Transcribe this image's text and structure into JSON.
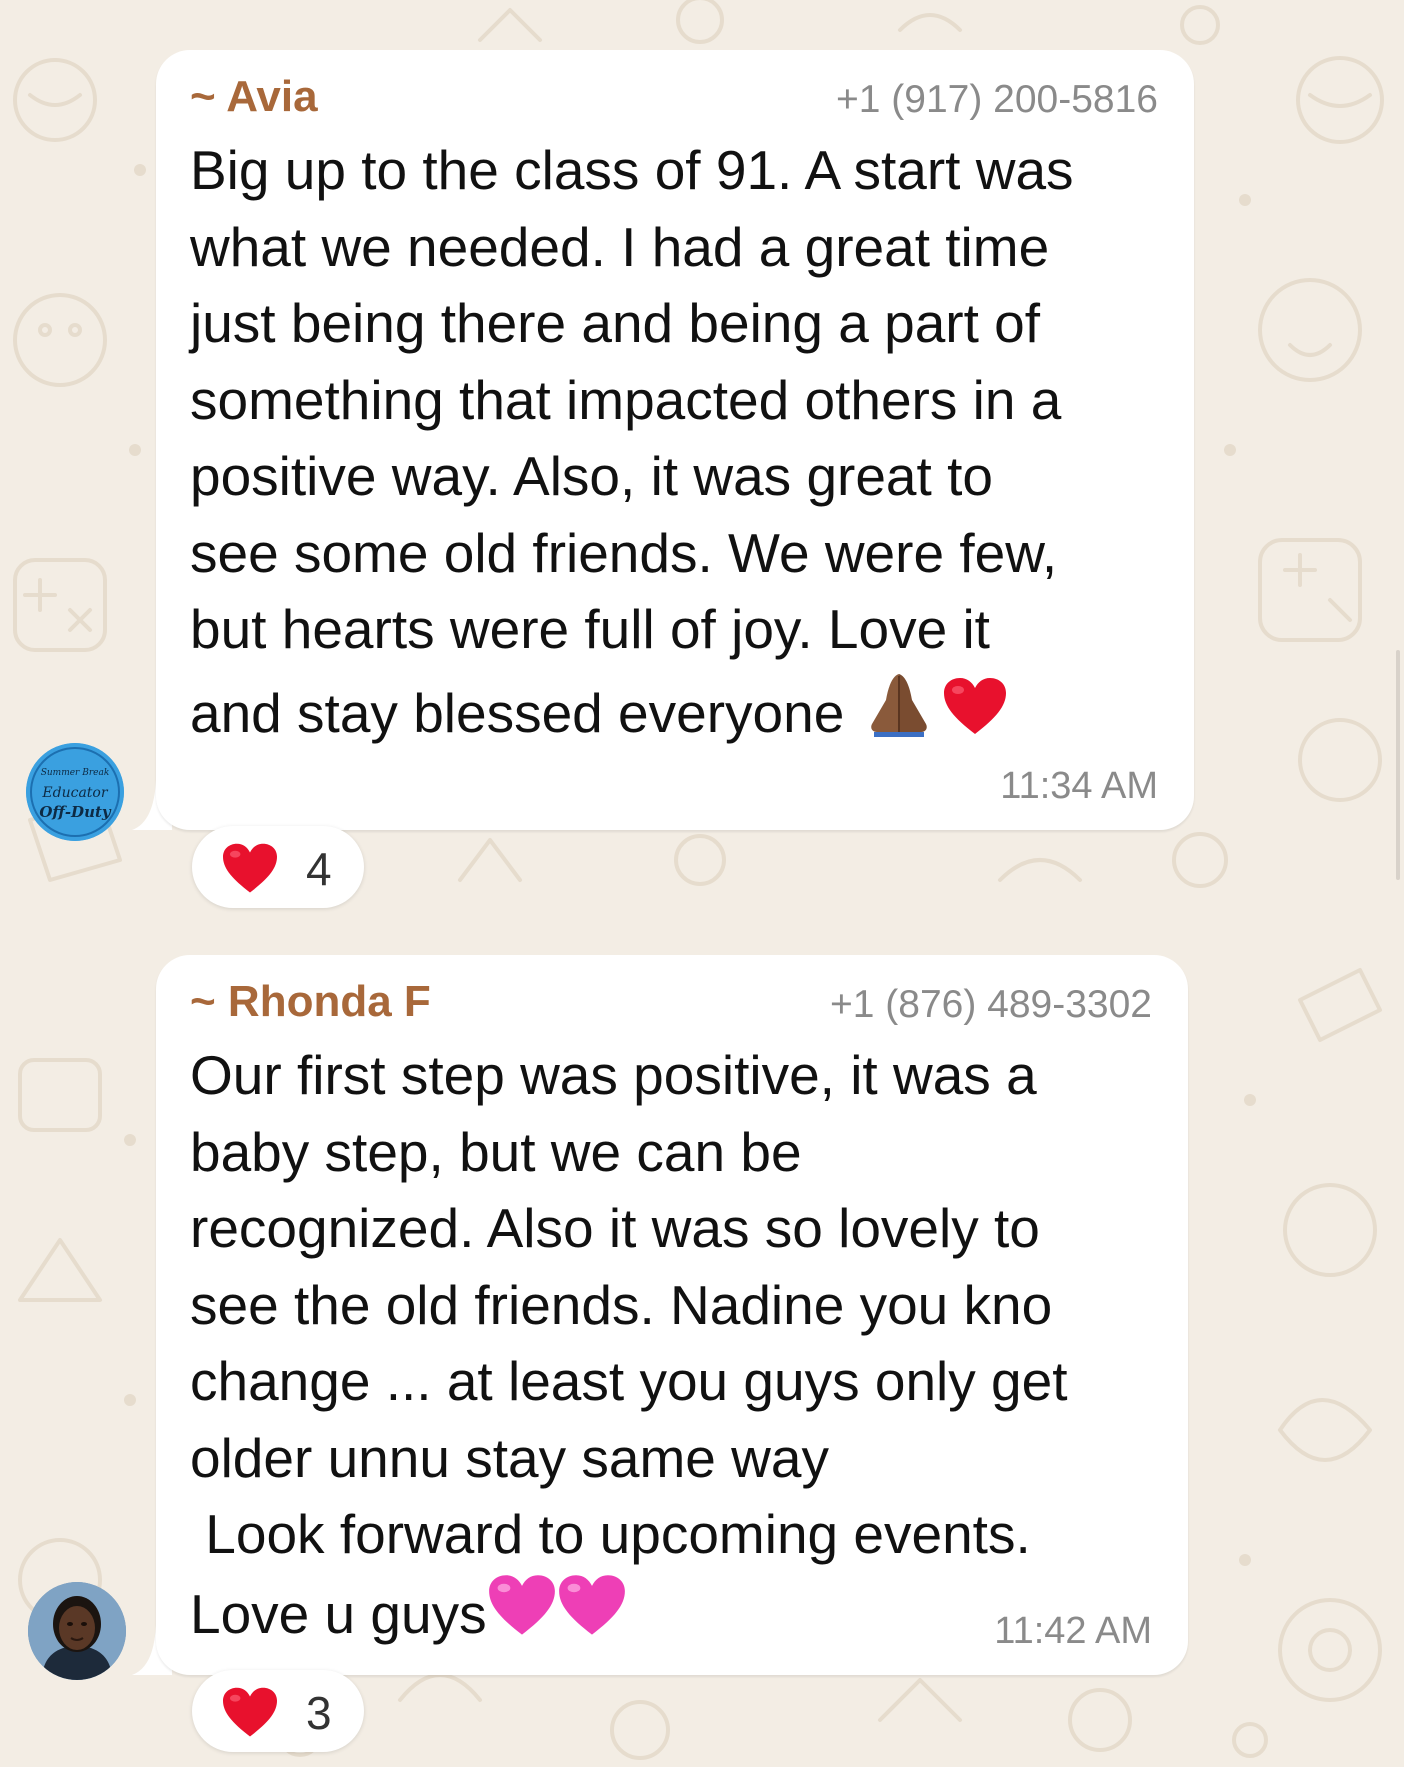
{
  "messages": [
    {
      "sender": "~ Avia",
      "phone": "+1 (917) 200-5816",
      "lines": [
        "Big up to the class of 91. A start was",
        "what we needed. I had a great time",
        "just being there and being a part of",
        "something that impacted others in a",
        "positive way. Also, it was great to",
        "see some old friends. We were few,",
        "but hearts were full of joy. Love it",
        "and stay blessed everyone"
      ],
      "trailing_emojis": [
        "folded-hands-icon",
        "red-heart-icon"
      ],
      "time": "11:34 AM",
      "reaction": {
        "emoji": "red-heart-icon",
        "count": "4"
      },
      "avatar_text": [
        "Summer Break",
        "Educator",
        "Off-Duty"
      ]
    },
    {
      "sender": "~ Rhonda F",
      "phone": "+1 (876) 489-3302",
      "lines": [
        "Our first step was positive, it was a",
        "baby step, but we can be",
        "recognized. Also it was so lovely to",
        "see the old friends. Nadine you kno",
        "change ... at least you guys only get",
        "older unnu stay same way",
        " Look forward to upcoming events.",
        "Love u guys"
      ],
      "trailing_emojis": [
        "pink-heart-icon",
        "pink-heart-icon"
      ],
      "time": "11:42 AM",
      "reaction": {
        "emoji": "red-heart-icon",
        "count": "3"
      }
    }
  ],
  "colors": {
    "background": "#f3ede4",
    "bubble": "#ffffff",
    "sender_name": "#a8683a",
    "meta_text": "#8a8a8a",
    "heart_red": "#e8112d",
    "heart_pink": "#ee3fb6"
  }
}
